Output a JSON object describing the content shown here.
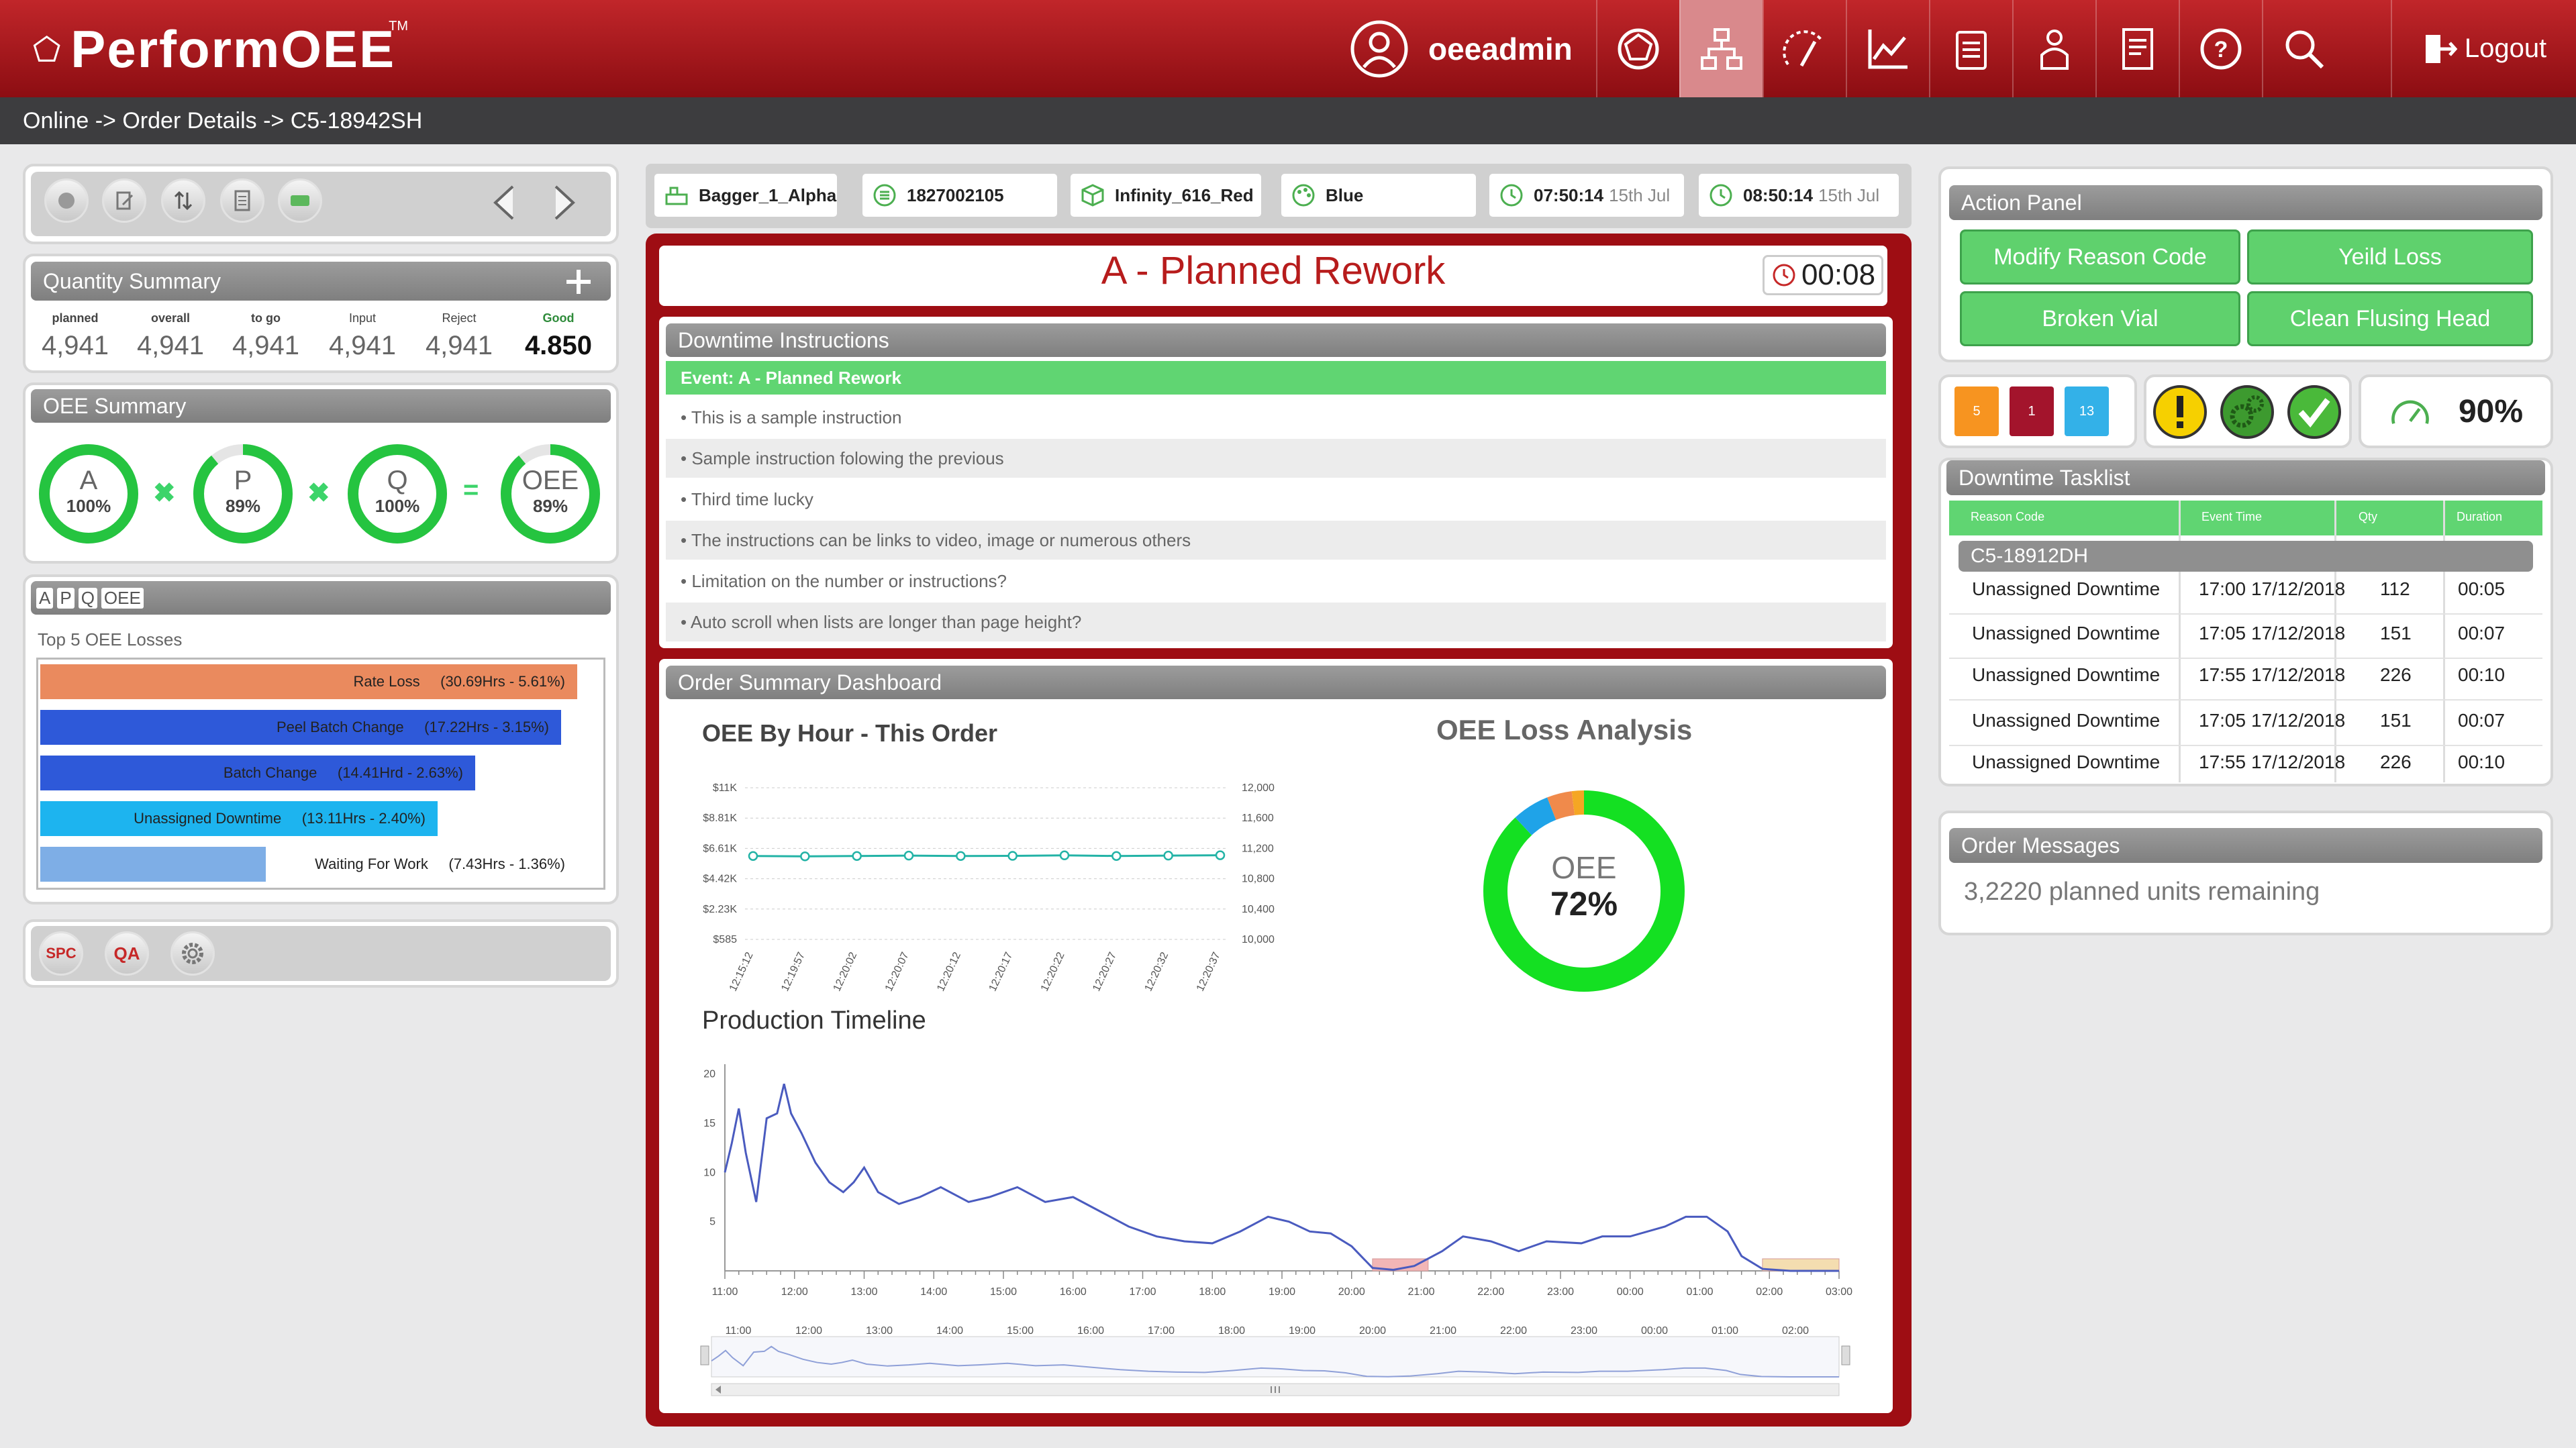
{
  "app": {
    "name": "PerformOEE",
    "tm": "TM",
    "user": "oeeadmin",
    "logout": "Logout"
  },
  "breadcrumb": "Online -> Order Details -> C5-18942SH",
  "quantity_summary": {
    "title": "Quantity Summary",
    "columns": [
      {
        "label": "planned",
        "value": "4,941"
      },
      {
        "label": "overall",
        "value": "4,941"
      },
      {
        "label": "to go",
        "value": "4,941"
      },
      {
        "label": "Input",
        "value": "4,941"
      },
      {
        "label": "Reject",
        "value": "4,941"
      },
      {
        "label": "Good",
        "value": "4.850"
      }
    ]
  },
  "oee_summary": {
    "title": "OEE  Summary",
    "rings": [
      {
        "letter": "A",
        "value": "100%",
        "fraction": 1.0
      },
      {
        "letter": "P",
        "value": "89%",
        "fraction": 0.89
      },
      {
        "letter": "Q",
        "value": "100%",
        "fraction": 1.0
      },
      {
        "letter": "OEE",
        "value": "89%",
        "fraction": 0.89
      }
    ],
    "ops": [
      "✖",
      "✖",
      "="
    ]
  },
  "losses": {
    "tabs": [
      "A",
      "P",
      "Q",
      "OEE"
    ],
    "title": "Top 5 OEE Losses",
    "items": [
      {
        "label": "Rate Loss",
        "detail": "(30.69Hrs - 5.61%)",
        "fraction": 1.0,
        "color": "#ea8a5e"
      },
      {
        "label": "Peel Batch Change",
        "detail": "(17.22Hrs - 3.15%)",
        "fraction": 0.97,
        "color": "#2e59d9"
      },
      {
        "label": "Batch Change",
        "detail": "(14.41Hrd - 2.63%)",
        "fraction": 0.81,
        "color": "#2e59d9"
      },
      {
        "label": "Unassigned Downtime",
        "detail": "(13.11Hrs - 2.40%)",
        "fraction": 0.74,
        "color": "#1db4ef"
      },
      {
        "label": "Waiting For Work",
        "detail": "(7.43Hrs - 1.36%)",
        "fraction": 0.42,
        "color": "#7eaee6"
      }
    ]
  },
  "bottom_tools": [
    "SPC",
    "QA"
  ],
  "info_bar": [
    {
      "text": "Bagger_1_Alpha",
      "icon": "machine-icon"
    },
    {
      "text": "1827002105",
      "icon": "order-icon"
    },
    {
      "text": "Infinity_616_Red",
      "icon": "product-icon"
    },
    {
      "text": "Blue",
      "icon": "palette-icon"
    },
    {
      "text": "07:50:14",
      "date": "15th Jul",
      "icon": "clock-icon"
    },
    {
      "text": "08:50:14",
      "date": "15th Jul",
      "icon": "clock-icon"
    }
  ],
  "event": {
    "title": "A - Planned Rework",
    "timer": "00:08"
  },
  "downtime_instructions": {
    "title": "Downtime Instructions",
    "event": "Event: A - Planned Rework",
    "items": [
      "This is a sample instruction",
      "Sample instruction folowing the previous",
      "Third time lucky",
      "The instructions can be links to video, image or numerous others",
      "Limitation on the number or instructions?",
      "Auto scroll when lists are longer than page height?"
    ]
  },
  "dashboard": {
    "title": "Order Summary Dashboard"
  },
  "chart_data": [
    {
      "type": "line",
      "title": "OEE By Hour - This Order",
      "x": [
        "12:15:12",
        "12:19:57",
        "12:20:02",
        "12:20:07",
        "12:20:12",
        "12:20:17",
        "12:20:22",
        "12:20:27",
        "12:20:32",
        "12:20:37"
      ],
      "y_left_ticks": [
        "$11K",
        "$8.81K",
        "$6.61K",
        "$4.42K",
        "$2.23K",
        "$585"
      ],
      "y_right_ticks": [
        "12,000",
        "11,600",
        "11,200",
        "10,800",
        "10,400",
        "10,000"
      ],
      "series": [
        {
          "values": [
            11100,
            11095,
            11100,
            11105,
            11100,
            11102,
            11108,
            11100,
            11105,
            11110
          ]
        }
      ],
      "ylim": [
        10000,
        12000
      ],
      "grid": true
    },
    {
      "type": "pie",
      "title": "OEE Loss Analysis",
      "center_label": "OEE",
      "center_value": "72%",
      "slices": [
        {
          "value": 88,
          "color": "#14e022"
        },
        {
          "value": 6,
          "color": "#1fa3e8"
        },
        {
          "value": 4,
          "color": "#f08a4b"
        },
        {
          "value": 2,
          "color": "#f5a623"
        }
      ]
    },
    {
      "type": "line",
      "title": "Production Timeline",
      "x_ticks": [
        "11:00",
        "12:00",
        "13:00",
        "14:00",
        "15:00",
        "16:00",
        "17:00",
        "18:00",
        "19:00",
        "20:00",
        "21:00",
        "22:00",
        "23:00",
        "00:00",
        "01:00",
        "02:00",
        "03:00"
      ],
      "y_ticks": [
        "20",
        "15",
        "10",
        "5"
      ],
      "ylim": [
        0,
        21
      ],
      "xlim": [
        0,
        16
      ],
      "series": [
        {
          "points": [
            [
              0.0,
              10
            ],
            [
              0.1,
              13
            ],
            [
              0.2,
              16.5
            ],
            [
              0.3,
              12
            ],
            [
              0.45,
              7
            ],
            [
              0.6,
              15.5
            ],
            [
              0.75,
              16
            ],
            [
              0.85,
              19
            ],
            [
              0.95,
              16
            ],
            [
              1.1,
              14
            ],
            [
              1.3,
              11
            ],
            [
              1.5,
              9
            ],
            [
              1.7,
              8
            ],
            [
              1.85,
              9
            ],
            [
              2.0,
              10.5
            ],
            [
              2.2,
              8
            ],
            [
              2.5,
              6.8
            ],
            [
              2.8,
              7.5
            ],
            [
              3.1,
              8.5
            ],
            [
              3.5,
              7
            ],
            [
              3.8,
              7.5
            ],
            [
              4.2,
              8.5
            ],
            [
              4.6,
              7
            ],
            [
              5.0,
              7.5
            ],
            [
              5.4,
              6
            ],
            [
              5.8,
              4.5
            ],
            [
              6.2,
              3.5
            ],
            [
              6.6,
              3
            ],
            [
              7.0,
              2.8
            ],
            [
              7.4,
              4
            ],
            [
              7.8,
              5.5
            ],
            [
              8.1,
              5
            ],
            [
              8.4,
              4
            ],
            [
              8.7,
              3.8
            ],
            [
              9.0,
              2.5
            ],
            [
              9.3,
              0.3
            ],
            [
              9.6,
              0.1
            ],
            [
              9.9,
              0.5
            ],
            [
              10.3,
              2
            ],
            [
              10.6,
              3.5
            ],
            [
              11.0,
              3
            ],
            [
              11.4,
              2
            ],
            [
              11.8,
              3
            ],
            [
              12.3,
              2.8
            ],
            [
              12.6,
              3.5
            ],
            [
              13.0,
              3.5
            ],
            [
              13.5,
              4.5
            ],
            [
              13.8,
              5.5
            ],
            [
              14.1,
              5.5
            ],
            [
              14.4,
              4
            ],
            [
              14.6,
              1.5
            ],
            [
              14.9,
              0.2
            ],
            [
              15.3,
              0
            ],
            [
              16.0,
              0
            ]
          ]
        }
      ],
      "bands": [
        {
          "from": 9.3,
          "to": 10.1,
          "color": "#f2b6b6"
        },
        {
          "from": 14.9,
          "to": 16.0,
          "color": "#f4ddb0"
        }
      ],
      "nav_ticks": [
        "11:00",
        "12:00",
        "13:00",
        "14:00",
        "15:00",
        "16:00",
        "17:00",
        "18:00",
        "19:00",
        "20:00",
        "21:00",
        "22:00",
        "23:00",
        "00:00",
        "01:00",
        "02:00"
      ]
    }
  ],
  "action_panel": {
    "title": "Action Panel",
    "buttons": [
      "Modify Reason Code",
      "Yeild Loss",
      "Broken Vial",
      "Clean Flusing Head"
    ]
  },
  "status": {
    "counts": [
      {
        "value": "5",
        "color": "#f79420"
      },
      {
        "value": "1",
        "color": "#a3142c"
      },
      {
        "value": "13",
        "color": "#33b1e8"
      }
    ],
    "performance": "90%"
  },
  "tasklist": {
    "title": "Downtime Tasklist",
    "headers": [
      "Reason Code",
      "Event Time",
      "Qty",
      "Duration"
    ],
    "order": "C5-18912DH",
    "rows": [
      {
        "reason": "Unassigned Downtime",
        "time": "17:00",
        "date": "17/12/2018",
        "qty": "112",
        "duration": "00:05"
      },
      {
        "reason": "Unassigned Downtime",
        "time": "17:05",
        "date": "17/12/2018",
        "qty": "151",
        "duration": "00:07"
      },
      {
        "reason": "Unassigned Downtime",
        "time": "17:55",
        "date": "17/12/2018",
        "qty": "226",
        "duration": "00:10"
      },
      {
        "reason": "Unassigned Downtime",
        "time": "17:05",
        "date": "17/12/2018",
        "qty": "151",
        "duration": "00:07"
      },
      {
        "reason": "Unassigned Downtime",
        "time": "17:55",
        "date": "17/12/2018",
        "qty": "226",
        "duration": "00:10"
      }
    ]
  },
  "order_messages": {
    "title": "Order Messages",
    "text": "3,2220 planned units remaining"
  }
}
